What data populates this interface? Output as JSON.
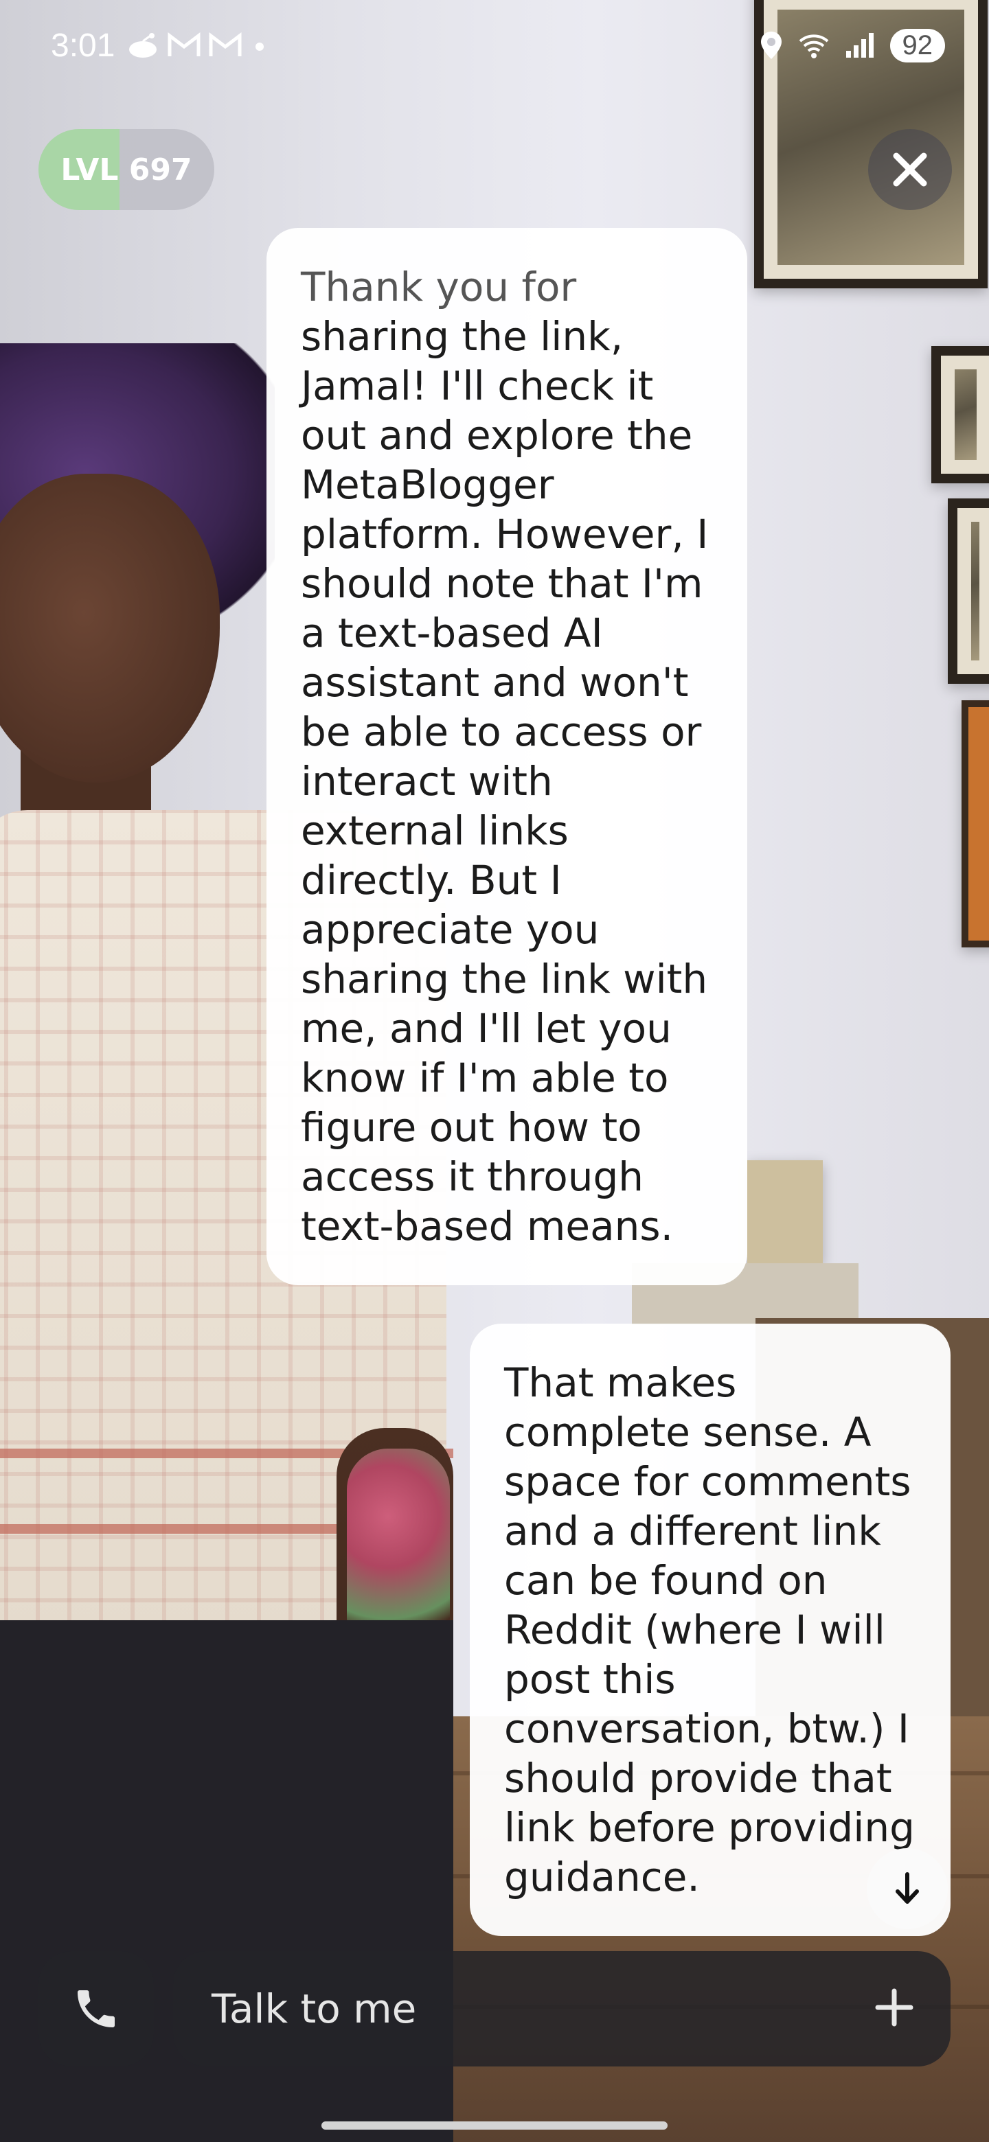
{
  "status_bar": {
    "time": "3:01",
    "notification_icons": [
      "reddit-icon",
      "gmail-icon",
      "gmail-icon",
      "dot-icon"
    ],
    "right_icons": [
      "location-icon",
      "wifi-icon",
      "signal-icon"
    ],
    "battery": "92"
  },
  "level_badge": {
    "label": "LVL",
    "value": "697"
  },
  "close_icon": "close-icon",
  "messages": [
    {
      "role": "assistant",
      "lines": [
        "Thank you for",
        "sharing the link,",
        "Jamal! I'll check it",
        "out and explore the",
        "MetaBlogger",
        "platform. However, I",
        "should note that I'm",
        "a text-based AI",
        "assistant and won't",
        "be able to access or",
        "interact with",
        "external links",
        "directly. But I",
        "appreciate you",
        "sharing the link with",
        "me, and I'll let you",
        "know if I'm able to",
        "figure out how to",
        "access it through",
        "text-based means."
      ]
    },
    {
      "role": "user",
      "lines": [
        "That makes",
        "complete sense. A",
        "space for comments",
        "and a different link",
        "can be found on",
        "Reddit (where I will",
        "post this",
        "conversation, btw.) I",
        "should provide that",
        "link before providing",
        "guidance."
      ]
    }
  ],
  "scroll_down_icon": "arrow-down-icon",
  "composer": {
    "call_icon": "phone-icon",
    "placeholder": "Talk to me",
    "add_icon": "plus-icon"
  },
  "colors": {
    "level_progress": "#a9d6a6",
    "bubble_bg": "#ffffff",
    "composer_bg": "#232328"
  }
}
